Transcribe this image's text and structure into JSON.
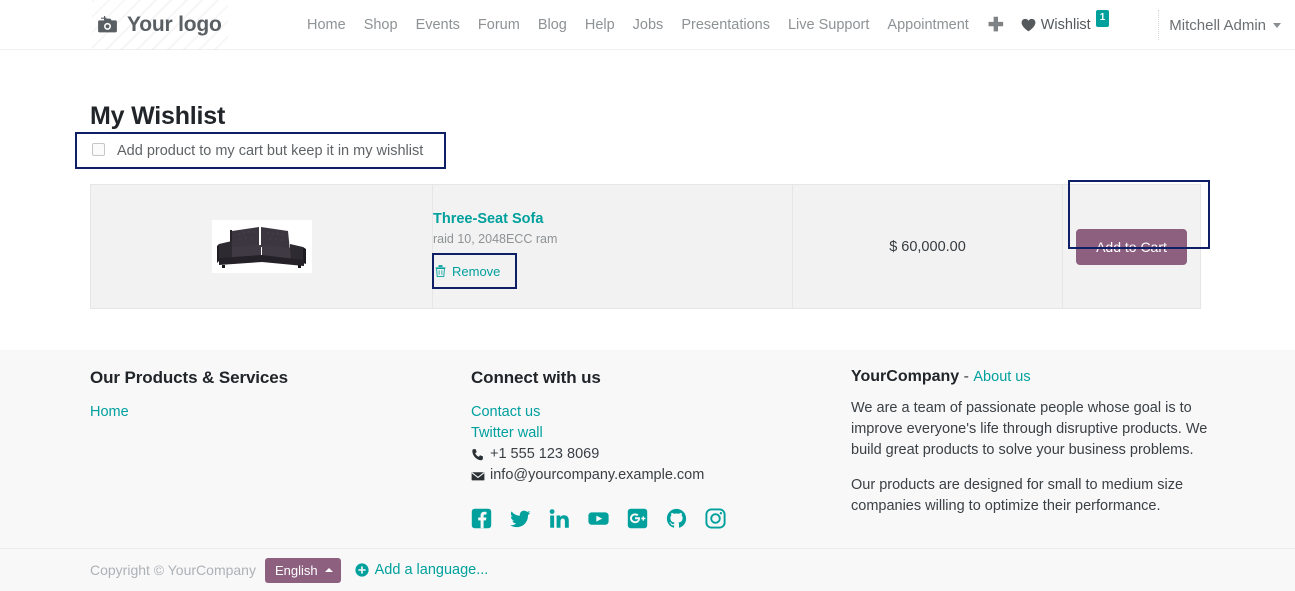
{
  "header": {
    "brand": {
      "text": "Your logo",
      "icon": "camera-icon"
    },
    "nav_items": [
      {
        "label": "Home"
      },
      {
        "label": "Shop"
      },
      {
        "label": "Events"
      },
      {
        "label": "Forum"
      },
      {
        "label": "Blog"
      },
      {
        "label": "Help"
      },
      {
        "label": "Jobs"
      },
      {
        "label": "Presentations"
      },
      {
        "label": "Live Support"
      },
      {
        "label": "Appointment"
      }
    ],
    "plus_icon": "plus-icon",
    "wishlist": {
      "label": "Wishlist",
      "icon": "heart-icon",
      "badge_count": "1"
    },
    "user": {
      "name": "Mitchell Admin",
      "icon": "chevron-down-icon"
    }
  },
  "main": {
    "page_title": "My Wishlist",
    "keep_in_wishlist": {
      "label": "Add product to my cart but keep it in my wishlist",
      "checked": false
    },
    "rows": [
      {
        "image_alt": "Three-Seat Sofa",
        "name": "Three-Seat Sofa",
        "description": "raid 10, 2048ECC ram",
        "remove_label": "Remove",
        "remove_icon": "trash-icon",
        "price": "$ 60,000.00",
        "add_to_cart_label": "Add to Cart"
      }
    ]
  },
  "footer": {
    "col1": {
      "heading": "Our Products & Services",
      "links": [
        {
          "label": "Home"
        }
      ]
    },
    "col2": {
      "heading": "Connect with us",
      "links": [
        {
          "label": "Contact us"
        },
        {
          "label": "Twitter wall"
        }
      ],
      "phone": "+1 555 123 8069",
      "phone_icon": "phone-icon",
      "email": "info@yourcompany.example.com",
      "email_icon": "envelope-icon",
      "social": [
        {
          "name": "facebook-icon"
        },
        {
          "name": "twitter-icon"
        },
        {
          "name": "linkedin-icon"
        },
        {
          "name": "youtube-icon"
        },
        {
          "name": "googleplus-icon"
        },
        {
          "name": "github-icon"
        },
        {
          "name": "instagram-icon"
        }
      ]
    },
    "col3": {
      "company": "YourCompany",
      "separator": "-",
      "about_label": "About us",
      "paragraph1": "We are a team of passionate people whose goal is to improve everyone's life through disruptive products. We build great products to solve your business problems.",
      "paragraph2": "Our products are designed for small to medium size companies willing to optimize their performance."
    },
    "copyright": "Copyright © YourCompany",
    "language_button": "English",
    "add_language": "Add a language...",
    "add_language_icon": "plus-circle-icon"
  },
  "colors": {
    "accent_teal": "#00a09d",
    "button_mauve": "#8e6080",
    "annotation_navy": "#0e1f66",
    "row_bg": "#f2f2f2",
    "footer_bg": "#f8f8f9"
  }
}
